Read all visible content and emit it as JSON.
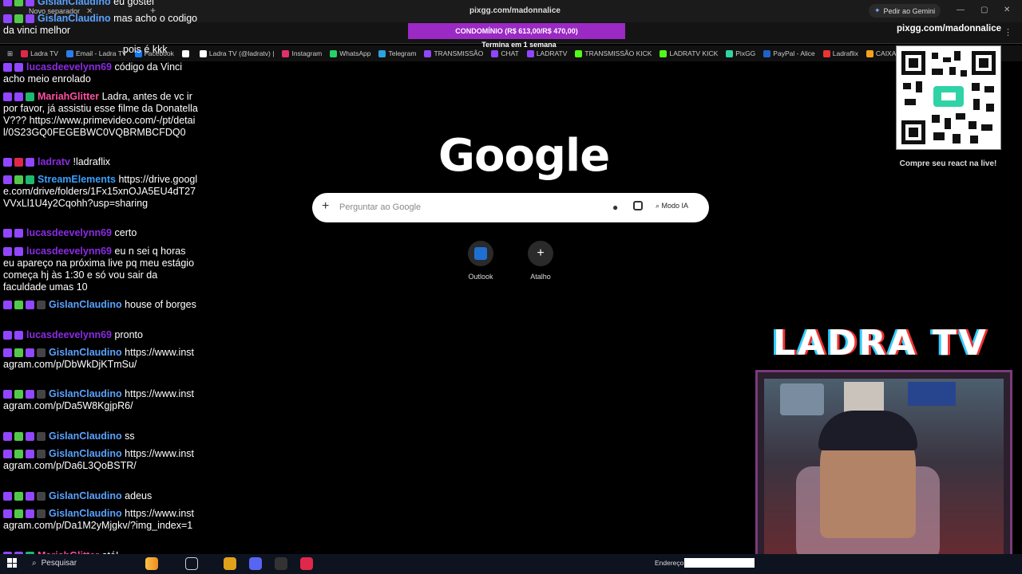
{
  "browser": {
    "tab_title": "Novo separador",
    "new_tab": "+",
    "window_title": "pixgg.com/madonnalice",
    "gemini": "Pedir ao Gemini",
    "win_min": "—",
    "win_max": "▢",
    "win_close": "✕",
    "menu": "⋮",
    "bookmarks": [
      {
        "label": "Ladra TV",
        "color": "#e0284a"
      },
      {
        "label": "Email - Ladra TV",
        "color": "#2b7de9"
      },
      {
        "label": "Facebook",
        "color": "#1877f2"
      },
      {
        "label": "",
        "color": "#ffffff"
      },
      {
        "label": "Ladra TV (@ladratv) |",
        "color": "#ffffff"
      },
      {
        "label": "Instagram",
        "color": "#e1306c"
      },
      {
        "label": "WhatsApp",
        "color": "#25d366"
      },
      {
        "label": "Telegram",
        "color": "#2aa3df"
      },
      {
        "label": "TRANSMISSÃO",
        "color": "#9146ff"
      },
      {
        "label": "CHAT",
        "color": "#9146ff"
      },
      {
        "label": "LADRATV",
        "color": "#9146ff"
      },
      {
        "label": "TRANSMISSÃO KICK",
        "color": "#53fc18"
      },
      {
        "label": "LADRATV KICK",
        "color": "#53fc18"
      },
      {
        "label": "PixGG",
        "color": "#33d3a4"
      },
      {
        "label": "PayPal - Alice",
        "color": "#1f63c6"
      },
      {
        "label": "Ladraflix",
        "color": "#e33"
      },
      {
        "label": "CAIXA",
        "color": "#f5a31a"
      }
    ]
  },
  "google": {
    "logo": "Google",
    "search_placeholder": "Perguntar ao Google",
    "plus": "+",
    "mic": "🎤",
    "ai_mode": "Modo IA",
    "shortcuts": [
      {
        "label": "Outlook",
        "icon": "✉"
      },
      {
        "label": "Atalho",
        "icon": "+"
      }
    ]
  },
  "overlay": {
    "pix_url": "pixgg.com/madonnalice",
    "qr_caption": "Compre seu react na live!",
    "banner": "CONDOMÍNIO (R$ 613,00/R$ 470,00)",
    "banner_sub": "Termina em 1 semana",
    "ladra_logo": "LADRA TV"
  },
  "chat": [
    {
      "user": "GislanClaudino",
      "color": "#5aa2ff",
      "text": "eu gostei",
      "badges": [
        "#9146ff",
        "#53c94c",
        "#9146ff"
      ]
    },
    {
      "user": "GislanClaudino",
      "color": "#5aa2ff",
      "text": "mas acho o codigo da vinci melhor",
      "badges": [
        "#9146ff",
        "#53c94c",
        "#9146ff"
      ]
    },
    {
      "user": "",
      "color": "#5aa2ff",
      "text": "pois é kkk",
      "badges": []
    },
    {
      "user": "lucasdeevelynn69",
      "color": "#8a2be2",
      "text": "código da Vinci acho meio enrolado",
      "badges": [
        "#9146ff",
        "#9146ff"
      ]
    },
    {
      "user": "MariahGlitter",
      "color": "#ff4fa3",
      "text": "Ladra, antes de vc ir por favor, já assistiu esse filme da Donatella V??? https://www.primevideo.com/-/pt/detail/0S23GQ0FEGEBWC0VQBRMBCFDQ0",
      "badges": [
        "#9146ff",
        "#9146ff",
        "#1fb86f"
      ]
    },
    {
      "user": "ladratv",
      "color": "#8a2be2",
      "text": "!ladraflix",
      "badges": [
        "#9146ff",
        "#e0284a",
        "#9146ff"
      ]
    },
    {
      "user": "StreamElements",
      "color": "#3aa0ff",
      "text": "https://drive.google.com/drive/folders/1Fx15xnOJA5EU4dT27VVxLl1U4y2Cqohh?usp=sharing",
      "badges": [
        "#9146ff",
        "#53c94c",
        "#1fb86f"
      ]
    },
    {
      "user": "lucasdeevelynn69",
      "color": "#8a2be2",
      "text": "certo",
      "badges": [
        "#9146ff",
        "#9146ff"
      ]
    },
    {
      "user": "lucasdeevelynn69",
      "color": "#8a2be2",
      "text": "eu n sei q horas eu apareço na próxima live pq meu estágio começa hj às 1:30 e só vou sair da faculdade umas 10",
      "badges": [
        "#9146ff",
        "#9146ff"
      ]
    },
    {
      "user": "GislanClaudino",
      "color": "#5aa2ff",
      "text": "house of borges",
      "badges": [
        "#9146ff",
        "#53c94c",
        "#9146ff",
        "#444"
      ]
    },
    {
      "user": "lucasdeevelynn69",
      "color": "#8a2be2",
      "text": "pronto",
      "badges": [
        "#9146ff",
        "#9146ff"
      ]
    },
    {
      "user": "GislanClaudino",
      "color": "#5aa2ff",
      "text": "https://www.instagram.com/p/DbWkDjKTmSu/",
      "badges": [
        "#9146ff",
        "#53c94c",
        "#9146ff",
        "#444"
      ]
    },
    {
      "user": "GislanClaudino",
      "color": "#5aa2ff",
      "text": "https://www.instagram.com/p/Da5W8KgjpR6/",
      "badges": [
        "#9146ff",
        "#53c94c",
        "#9146ff",
        "#444"
      ]
    },
    {
      "user": "GislanClaudino",
      "color": "#5aa2ff",
      "text": "ss",
      "badges": [
        "#9146ff",
        "#53c94c",
        "#9146ff",
        "#444"
      ]
    },
    {
      "user": "GislanClaudino",
      "color": "#5aa2ff",
      "text": "https://www.instagram.com/p/Da6L3QoBSTR/",
      "badges": [
        "#9146ff",
        "#53c94c",
        "#9146ff",
        "#444"
      ]
    },
    {
      "user": "GislanClaudino",
      "color": "#5aa2ff",
      "text": "adeus",
      "badges": [
        "#9146ff",
        "#53c94c",
        "#9146ff",
        "#444"
      ]
    },
    {
      "user": "GislanClaudino",
      "color": "#5aa2ff",
      "text": "https://www.instagram.com/p/Da1M2yMjgkv/?img_index=1",
      "badges": [
        "#9146ff",
        "#53c94c",
        "#9146ff",
        "#444"
      ]
    },
    {
      "user": "MariahGlitter",
      "color": "#ff4fa3",
      "text": "até!",
      "badges": [
        "#9146ff",
        "#9146ff",
        "#1fb86f"
      ]
    }
  ],
  "taskbar": {
    "search": "Pesquisar",
    "address_label": "Endereço",
    "icons": [
      {
        "name": "chrome-icon",
        "color": "#e0a21a"
      },
      {
        "name": "discord-icon",
        "color": "#5865f2"
      },
      {
        "name": "obs-icon",
        "color": "#333"
      },
      {
        "name": "streamlabs-icon",
        "color": "#e0284a"
      }
    ]
  }
}
